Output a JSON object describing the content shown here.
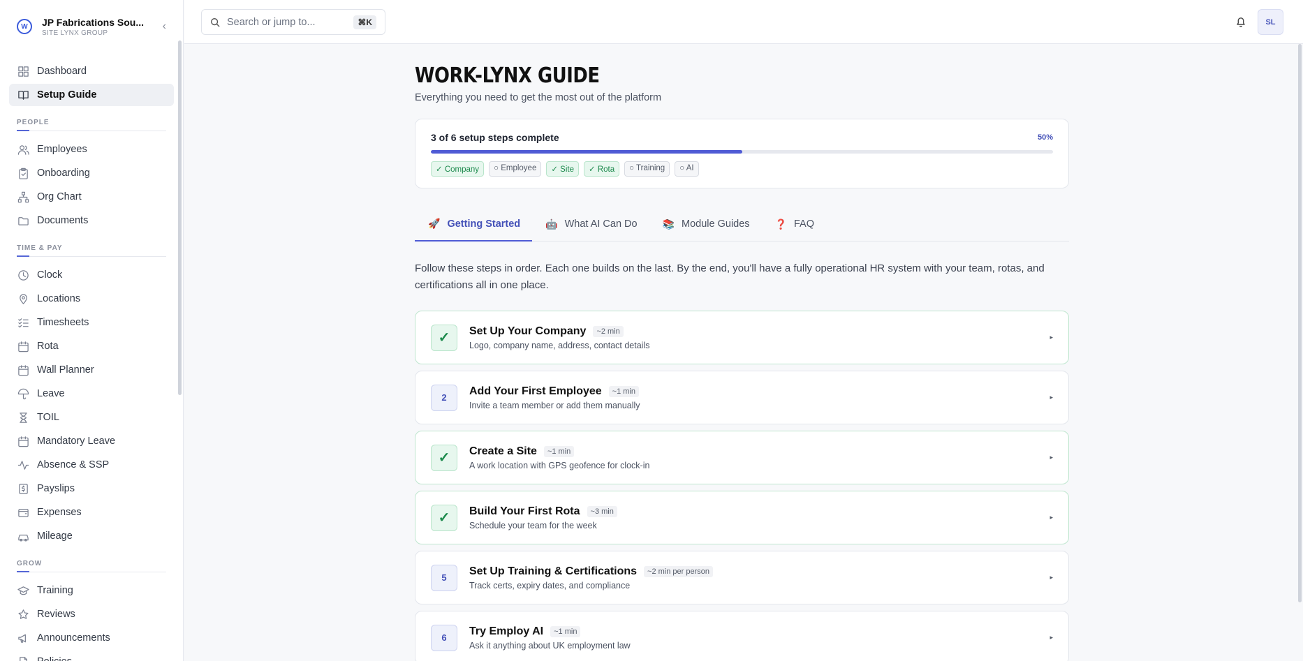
{
  "brand": {
    "name": "JP Fabrications Sou...",
    "sub": "SITE LYNX GROUP",
    "logo": "W"
  },
  "sidebar": {
    "top": [
      {
        "label": "Dashboard",
        "icon": "grid-icon"
      },
      {
        "label": "Setup Guide",
        "icon": "book-icon",
        "active": true
      }
    ],
    "sections": [
      {
        "title": "PEOPLE",
        "items": [
          {
            "label": "Employees",
            "icon": "users-icon"
          },
          {
            "label": "Onboarding",
            "icon": "clipboard-icon"
          },
          {
            "label": "Org Chart",
            "icon": "org-chart-icon"
          },
          {
            "label": "Documents",
            "icon": "folder-icon"
          }
        ]
      },
      {
        "title": "TIME & PAY",
        "items": [
          {
            "label": "Clock",
            "icon": "clock-icon"
          },
          {
            "label": "Locations",
            "icon": "pin-icon"
          },
          {
            "label": "Timesheets",
            "icon": "checklist-icon"
          },
          {
            "label": "Rota",
            "icon": "calendar-icon"
          },
          {
            "label": "Wall Planner",
            "icon": "calendar-icon"
          },
          {
            "label": "Leave",
            "icon": "umbrella-icon"
          },
          {
            "label": "TOIL",
            "icon": "hourglass-icon"
          },
          {
            "label": "Mandatory Leave",
            "icon": "calendar-icon"
          },
          {
            "label": "Absence & SSP",
            "icon": "activity-icon"
          },
          {
            "label": "Payslips",
            "icon": "payslip-icon"
          },
          {
            "label": "Expenses",
            "icon": "wallet-icon"
          },
          {
            "label": "Mileage",
            "icon": "car-icon"
          }
        ]
      },
      {
        "title": "GROW",
        "items": [
          {
            "label": "Training",
            "icon": "graduation-cap-icon"
          },
          {
            "label": "Reviews",
            "icon": "star-icon"
          },
          {
            "label": "Announcements",
            "icon": "megaphone-icon"
          },
          {
            "label": "Policies",
            "icon": "document-icon"
          }
        ]
      }
    ]
  },
  "search": {
    "placeholder": "Search or jump to...",
    "shortcut": "⌘K"
  },
  "user": {
    "initials": "SL"
  },
  "page": {
    "title": "WORK-LYNX GUIDE",
    "subtitle": "Everything you need to get the most out of the platform"
  },
  "progress": {
    "text": "3 of 6 setup steps complete",
    "percent_label": "50%",
    "fraction": 0.5,
    "chips": [
      {
        "label": "✓ Company",
        "done": true
      },
      {
        "label": "○ Employee",
        "done": false
      },
      {
        "label": "✓ Site",
        "done": true
      },
      {
        "label": "✓ Rota",
        "done": true
      },
      {
        "label": "○ Training",
        "done": false
      },
      {
        "label": "○ AI",
        "done": false
      }
    ]
  },
  "tabs": [
    {
      "emoji": "🚀",
      "label": "Getting Started",
      "active": true
    },
    {
      "emoji": "🤖",
      "label": "What AI Can Do",
      "active": false
    },
    {
      "emoji": "📚",
      "label": "Module Guides",
      "active": false
    },
    {
      "emoji": "❓",
      "label": "FAQ",
      "active": false
    }
  ],
  "intro": "Follow these steps in order. Each one builds on the last. By the end, you'll have a fully operational HR system with your team, rotas, and certifications all in one place.",
  "steps": [
    {
      "badge": "✓",
      "done": true,
      "title": "Set Up Your Company",
      "time": "~2 min",
      "desc": "Logo, company name, address, contact details"
    },
    {
      "badge": "2",
      "done": false,
      "title": "Add Your First Employee",
      "time": "~1 min",
      "desc": "Invite a team member or add them manually"
    },
    {
      "badge": "✓",
      "done": true,
      "title": "Create a Site",
      "time": "~1 min",
      "desc": "A work location with GPS geofence for clock-in"
    },
    {
      "badge": "✓",
      "done": true,
      "title": "Build Your First Rota",
      "time": "~3 min",
      "desc": "Schedule your team for the week"
    },
    {
      "badge": "5",
      "done": false,
      "title": "Set Up Training & Certifications",
      "time": "~2 min per person",
      "desc": "Track certs, expiry dates, and compliance"
    },
    {
      "badge": "6",
      "done": false,
      "title": "Try Employ AI",
      "time": "~1 min",
      "desc": "Ask it anything about UK employment law"
    }
  ],
  "colors": {
    "accent": "#4f5bd5",
    "success": "#1d8a4d"
  }
}
